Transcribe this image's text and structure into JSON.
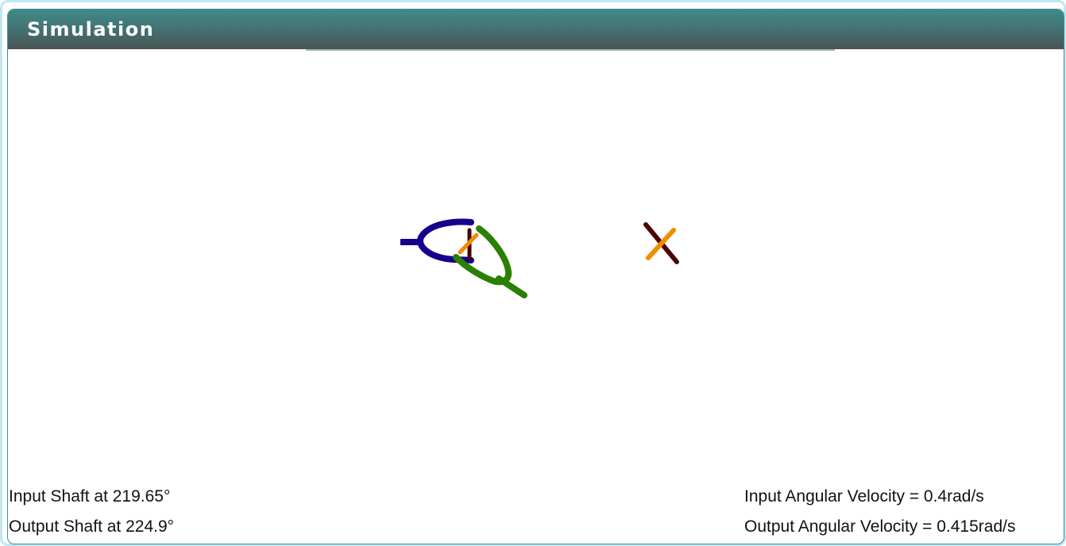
{
  "panel": {
    "title": "Simulation"
  },
  "readouts": {
    "input_shaft": "Input Shaft at 219.65°",
    "output_shaft": "Output Shaft at 224.9°",
    "input_velocity": "Input Angular Velocity = 0.4rad/s",
    "output_velocity": "Output Angular Velocity = 0.415rad/s"
  },
  "simulation": {
    "input_shaft_angle_deg": 219.65,
    "output_shaft_angle_deg": 224.9,
    "input_angular_velocity_rad_s": 0.4,
    "output_angular_velocity_rad_s": 0.415
  },
  "colors": {
    "header_top": "#3f8a86",
    "header_bottom": "#4a5454",
    "input_yoke": "#14008c",
    "output_yoke": "#2a8000",
    "cross_orange": "#f28c00",
    "cross_dark": "#4a0505",
    "panel_border": "#3d8e95",
    "outer_border": "#bfe6f1"
  }
}
